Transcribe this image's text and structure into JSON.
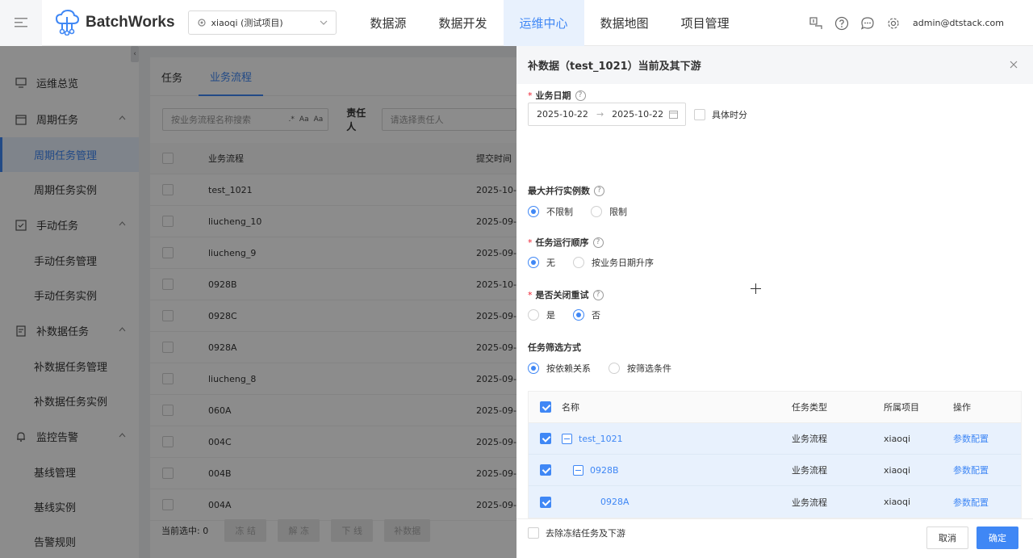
{
  "app": {
    "name": "BatchWorks"
  },
  "project": {
    "value": "xiaoqi (测试项目)"
  },
  "nav": [
    "数据源",
    "数据开发",
    "运维中心",
    "数据地图",
    "项目管理"
  ],
  "nav_active": "运维中心",
  "user": {
    "email": "admin@dtstack.com"
  },
  "sidebar": {
    "ops_overview": "运维总览",
    "periodic": {
      "label": "周期任务",
      "items": [
        "周期任务管理",
        "周期任务实例"
      ]
    },
    "manual": {
      "label": "手动任务",
      "items": [
        "手动任务管理",
        "手动任务实例"
      ]
    },
    "backfill": {
      "label": "补数据任务",
      "items": [
        "补数据任务管理",
        "补数据任务实例"
      ]
    },
    "monitor": {
      "label": "监控告警",
      "items": [
        "基线管理",
        "基线实例",
        "告警规则"
      ]
    }
  },
  "main": {
    "tabs": [
      "任务",
      "业务流程"
    ],
    "search_placeholder": "按业务流程名称搜索",
    "search_tags": [
      ".*",
      "Aa",
      "Aa"
    ],
    "owner_label": "责任人",
    "owner_placeholder": "请选择责任人",
    "columns": [
      "业务流程",
      "提交时间"
    ],
    "rows": [
      {
        "name": "test_1021",
        "time": "2025-10-"
      },
      {
        "name": "liucheng_10",
        "time": "2025-09-"
      },
      {
        "name": "liucheng_9",
        "time": "2025-09-"
      },
      {
        "name": "0928B",
        "time": "2025-10-"
      },
      {
        "name": "0928C",
        "time": "2025-09-"
      },
      {
        "name": "0928A",
        "time": "2025-09-"
      },
      {
        "name": "liucheng_8",
        "time": "2025-09-"
      },
      {
        "name": "060A",
        "time": "2025-09-"
      },
      {
        "name": "004C",
        "time": "2025-09-"
      },
      {
        "name": "004B",
        "time": "2025-09-"
      },
      {
        "name": "004A",
        "time": "2025-09-"
      }
    ],
    "selected_label": "当前选中: 0",
    "footer_buttons": [
      "冻 结",
      "解 冻",
      "下 线",
      "补数据"
    ]
  },
  "drawer": {
    "title": "补数据（test_1021）当前及其下游",
    "biz_date_label": "业务日期",
    "date_start": "2025-10-22",
    "date_end": "2025-10-22",
    "specific_time": "具体时分",
    "max_parallel_label": "最大并行实例数",
    "max_parallel_options": [
      "不限制",
      "限制"
    ],
    "order_label": "任务运行顺序",
    "order_options": [
      "无",
      "按业务日期升序"
    ],
    "retry_label": "是否关闭重试",
    "retry_options": [
      "是",
      "否"
    ],
    "filter_label": "任务筛选方式",
    "filter_options": [
      "按依赖关系",
      "按筛选条件"
    ],
    "table_columns": [
      "名称",
      "任务类型",
      "所属项目",
      "操作"
    ],
    "table_rows": [
      {
        "name": "test_1021",
        "type": "业务流程",
        "project": "xiaoqi",
        "op": "参数配置"
      },
      {
        "name": "0928B",
        "type": "业务流程",
        "project": "xiaoqi",
        "op": "参数配置"
      },
      {
        "name": "0928A",
        "type": "业务流程",
        "project": "xiaoqi",
        "op": "参数配置"
      }
    ],
    "exclude_frozen": "去除冻结任务及下游",
    "cancel": "取消",
    "ok": "确定"
  },
  "colors": {
    "primary": "#3f87f5",
    "required": "#e23"
  }
}
